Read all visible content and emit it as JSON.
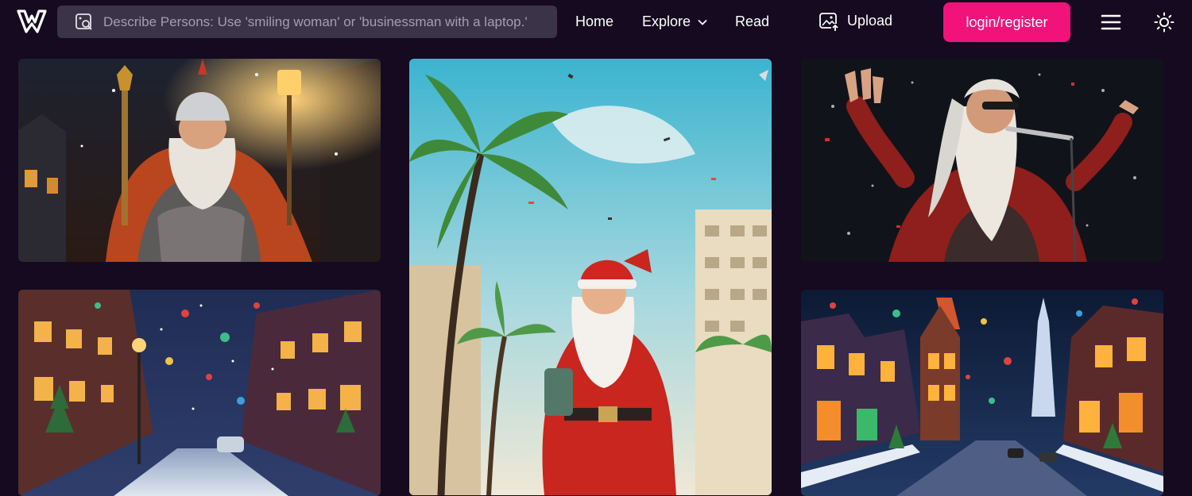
{
  "header": {
    "search": {
      "placeholder": "Describe Persons: Use 'smiling woman' or 'businessman with a laptop.'"
    },
    "nav": {
      "home": "Home",
      "explore": "Explore",
      "read": "Read",
      "upload": "Upload"
    },
    "login_label": "login/register",
    "icons": [
      "site-logo",
      "image-search-icon",
      "chevron-down-icon",
      "upload-image-icon",
      "hamburger-menu-icon",
      "sun-icon"
    ]
  },
  "gallery": {
    "items": [
      {
        "name": "santa-knight-lantern-image"
      },
      {
        "name": "santa-tropical-palms-image"
      },
      {
        "name": "santa-rockstar-singing-image"
      },
      {
        "name": "christmas-street-snow-image"
      },
      {
        "name": "christmas-colorful-town-image"
      }
    ]
  },
  "colors": {
    "background": "#150a1f",
    "search_bg": "#3b3347",
    "accent": "#f2137a"
  }
}
